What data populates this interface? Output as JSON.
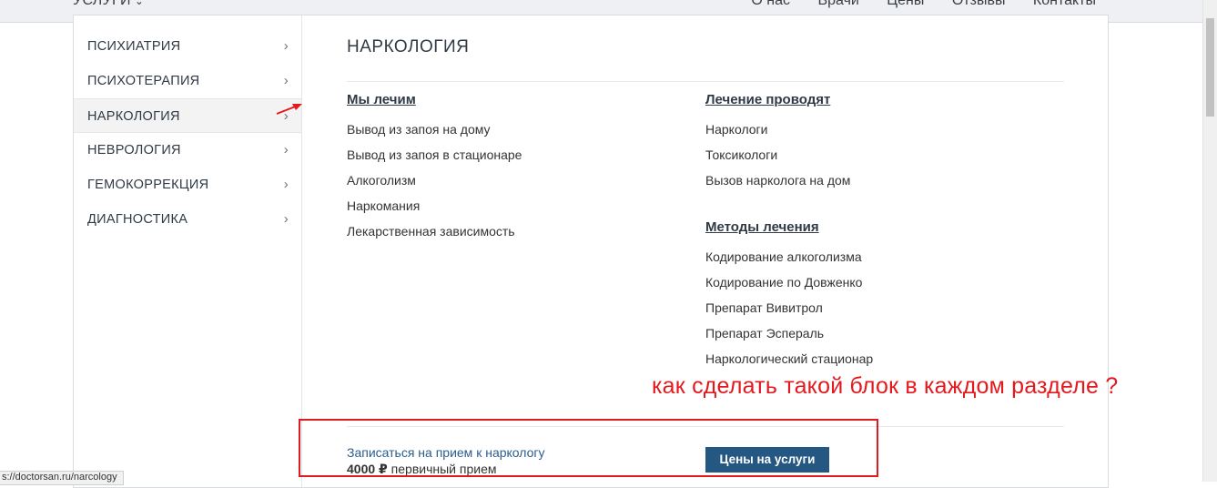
{
  "topnav": {
    "services_label": "УСЛУГИ",
    "links": [
      "О нас",
      "Врачи",
      "Цены",
      "Отзывы",
      "Контакты"
    ]
  },
  "sidebar": {
    "items": [
      {
        "label": "ПСИХИАТРИЯ"
      },
      {
        "label": "ПСИХОТЕРАПИЯ"
      },
      {
        "label": "НАРКОЛОГИЯ",
        "active": true
      },
      {
        "label": "НЕВРОЛОГИЯ"
      },
      {
        "label": "ГЕМОКОРРЕКЦИЯ"
      },
      {
        "label": "ДИАГНОСТИКА"
      }
    ]
  },
  "content": {
    "heading": "НАРКОЛОГИЯ",
    "col1": {
      "title": "Мы лечим",
      "links": [
        "Вывод из запоя на дому",
        "Вывод из запоя в стационаре",
        "Алкоголизм",
        "Наркомания",
        "Лекарственная зависимость"
      ]
    },
    "col2": {
      "title": "Лечение проводят",
      "links": [
        "Наркологи",
        "Токсикологи",
        "Вызов нарколога на дом"
      ]
    },
    "col3": {
      "title": "Методы лечения",
      "links": [
        "Кодирование алкоголизма",
        "Кодирование по Довженко",
        "Препарат Вивитрол",
        "Препарат Эспераль",
        "Наркологический стационар"
      ]
    },
    "signup_link": "Записаться на прием к наркологу",
    "price_value": "4000 ₽",
    "price_note": "первичный прием",
    "price_button": "Цены на услуги"
  },
  "annotation": {
    "question": "как сделать такой блок в каждом разделе ?",
    "color": "#e3191d"
  },
  "status_bar": {
    "url": "s://doctorsan.ru/narcology"
  }
}
